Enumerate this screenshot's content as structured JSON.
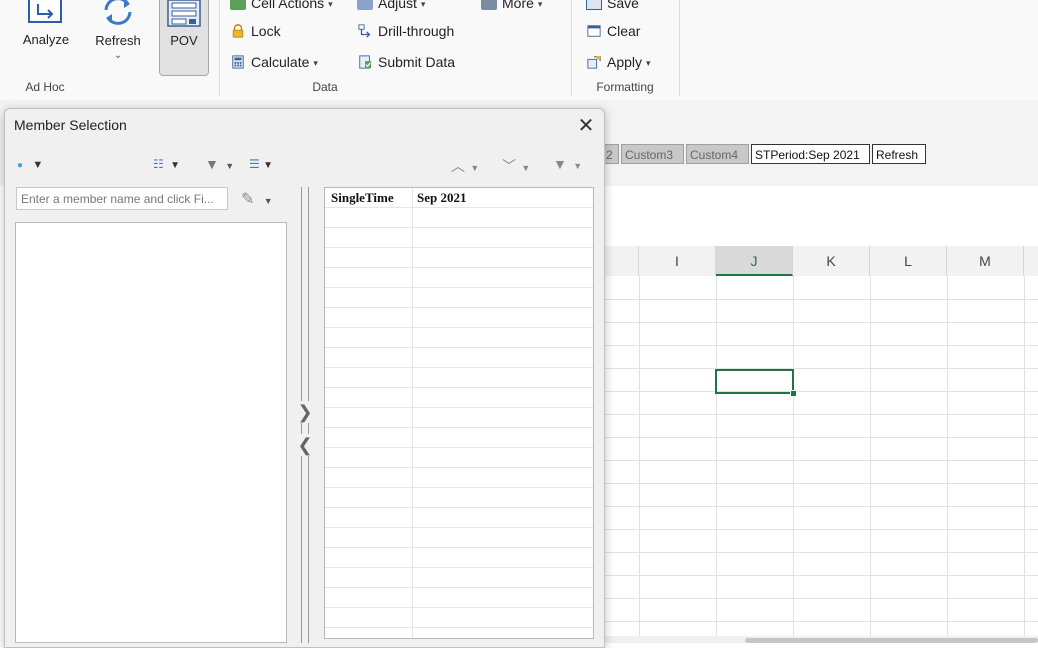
{
  "ribbon": {
    "adhoc": {
      "analyze_label": "Analyze",
      "refresh_label": "Refresh",
      "pov_label": "POV",
      "group_label": "Ad Hoc"
    },
    "data": {
      "cell_actions_label": "Cell Actions",
      "adjust_label": "Adjust",
      "more_label": "More",
      "lock_label": "Lock",
      "drill_through_label": "Drill-through",
      "calculate_label": "Calculate",
      "submit_data_label": "Submit Data",
      "group_label": "Data"
    },
    "formatting": {
      "save_label": "Save",
      "clear_label": "Clear",
      "apply_label": "Apply",
      "group_label": "Formatting"
    }
  },
  "pov_bar": {
    "items": [
      "2",
      "Custom3",
      "Custom4",
      "STPeriod:Sep 2021",
      "Refresh"
    ]
  },
  "grid": {
    "columns": [
      "I",
      "J",
      "K",
      "L",
      "M"
    ],
    "active_column": "J"
  },
  "dialog": {
    "title": "Member Selection",
    "search_placeholder": "Enter a member name and click Fi...",
    "selection_rows": [
      {
        "dimension": "SingleTime",
        "member": "Sep 2021"
      }
    ]
  },
  "colors": {
    "accent_green": "#217346",
    "ribbon_bg": "#f9f9f9",
    "dialog_bg": "#f0f0f0"
  }
}
